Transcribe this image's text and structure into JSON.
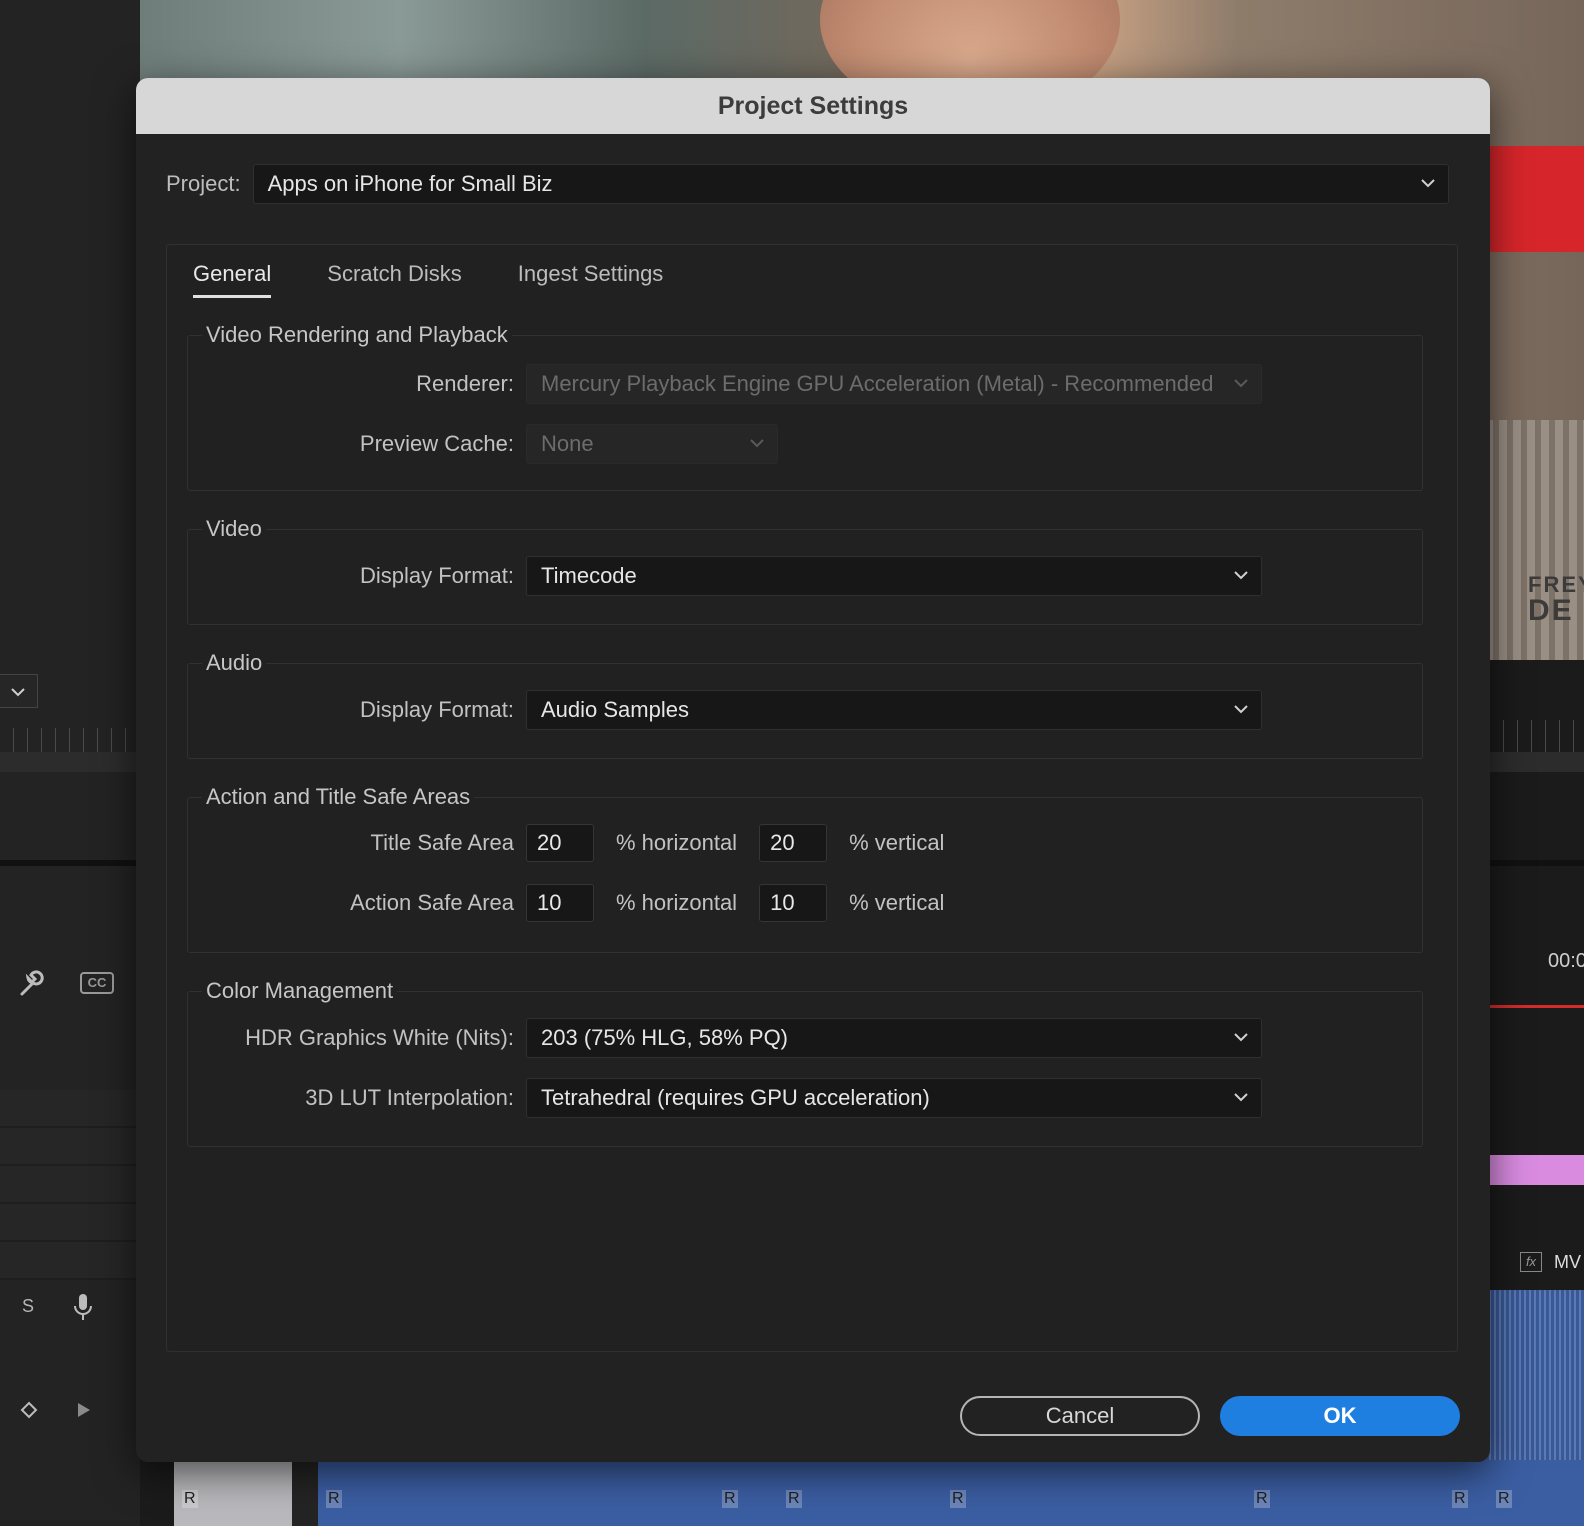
{
  "dialog": {
    "title": "Project Settings",
    "project_label": "Project:",
    "project_value": "Apps on iPhone for Small Biz",
    "tabs": [
      {
        "label": "General",
        "active": true
      },
      {
        "label": "Scratch Disks",
        "active": false
      },
      {
        "label": "Ingest Settings",
        "active": false
      }
    ],
    "video_rendering": {
      "legend": "Video Rendering and Playback",
      "renderer_label": "Renderer:",
      "renderer_value": "Mercury Playback Engine GPU Acceleration (Metal) - Recommended",
      "preview_cache_label": "Preview Cache:",
      "preview_cache_value": "None"
    },
    "video": {
      "legend": "Video",
      "display_format_label": "Display Format:",
      "display_format_value": "Timecode"
    },
    "audio": {
      "legend": "Audio",
      "display_format_label": "Display Format:",
      "display_format_value": "Audio Samples"
    },
    "safe_areas": {
      "legend": "Action and Title Safe Areas",
      "title_label": "Title Safe Area",
      "title_h": "20",
      "title_v": "20",
      "action_label": "Action Safe Area",
      "action_h": "10",
      "action_v": "10",
      "unit_h": "% horizontal",
      "unit_v": "% vertical"
    },
    "color": {
      "legend": "Color Management",
      "hdr_label": "HDR Graphics White (Nits):",
      "hdr_value": "203 (75% HLG, 58% PQ)",
      "lut_label": "3D LUT Interpolation:",
      "lut_value": "Tetrahedral (requires GPU acceleration)"
    },
    "buttons": {
      "cancel": "Cancel",
      "ok": "OK"
    }
  },
  "background": {
    "timecode": "00:0",
    "clip_label": "MV",
    "wall_text_1": "FREY",
    "wall_text_2": "DE",
    "track_marker": "R",
    "fx_label": "fx",
    "track_s": "S",
    "cc_label": "CC"
  },
  "colors": {
    "accent": "#1f7fe0",
    "dialog_bg": "#222222",
    "titlebar_bg": "#d7d7d7",
    "playhead": "#d42b2b"
  }
}
